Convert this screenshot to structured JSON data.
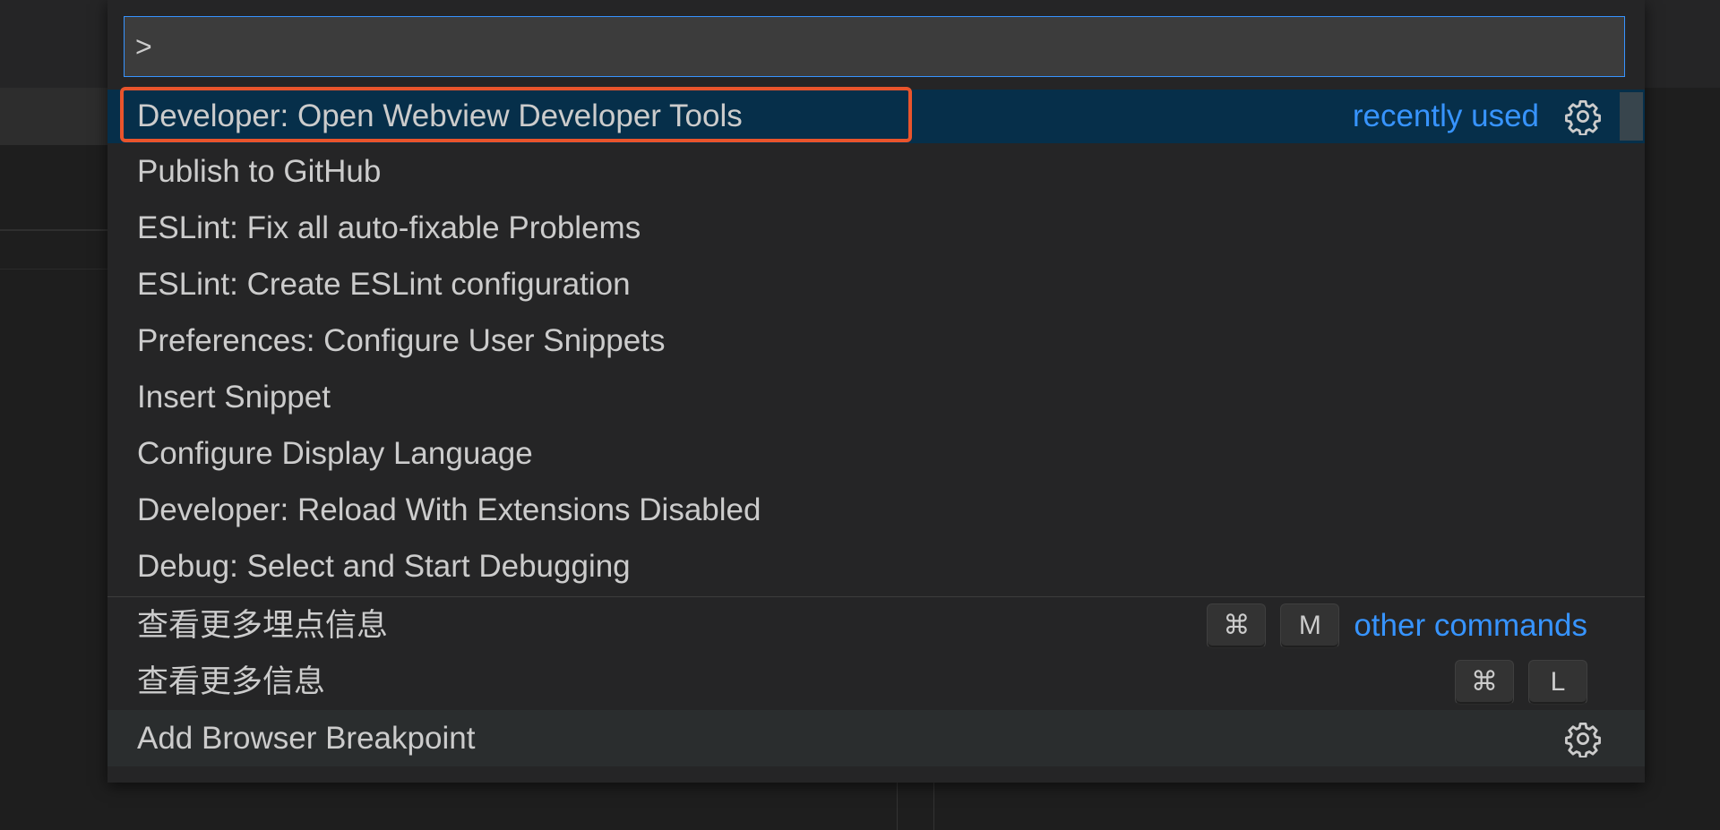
{
  "palette": {
    "input_value": ">",
    "items": [
      {
        "label": "Developer: Open Webview Developer Tools",
        "meta": "recently used"
      },
      {
        "label": "Publish to GitHub"
      },
      {
        "label": "ESLint: Fix all auto-fixable Problems"
      },
      {
        "label": "ESLint: Create ESLint configuration"
      },
      {
        "label": "Preferences: Configure User Snippets"
      },
      {
        "label": "Insert Snippet"
      },
      {
        "label": "Configure Display Language"
      },
      {
        "label": "Developer: Reload With Extensions Disabled"
      },
      {
        "label": "Debug: Select and Start Debugging"
      }
    ],
    "other_items": [
      {
        "label": "查看更多埋点信息",
        "keys": [
          "⌘",
          "M"
        ],
        "meta": "other commands"
      },
      {
        "label": "查看更多信息",
        "keys": [
          "⌘",
          "L"
        ]
      },
      {
        "label": "Add Browser Breakpoint"
      }
    ]
  },
  "colors": {
    "accent": "#3794ff",
    "selection": "#062f4a",
    "highlight_outline": "#e8542c",
    "background": "#252526"
  },
  "icons": {
    "settings": "gear-icon"
  }
}
